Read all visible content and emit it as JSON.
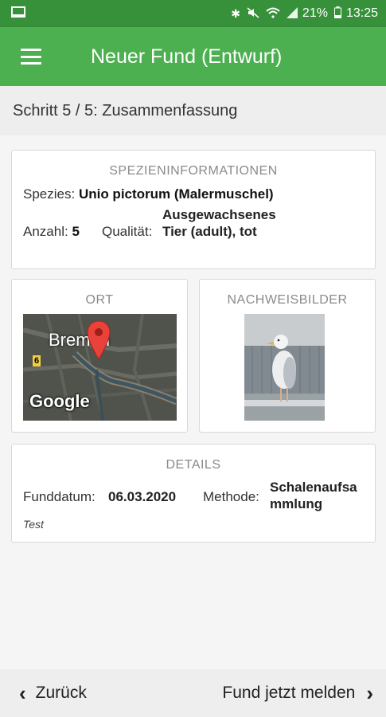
{
  "status_bar": {
    "battery": "21%",
    "time": "13:25"
  },
  "app_bar": {
    "title": "Neuer Fund (Entwurf)"
  },
  "step": {
    "text": "Schritt 5 / 5: Zusammenfassung"
  },
  "species_card": {
    "title": "SPEZIENINFORMATIONEN",
    "species_label": "Spezies:",
    "species_value": "Unio pictorum (Malermuschel)",
    "count_label": "Anzahl:",
    "count_value": "5",
    "quality_label": "Qualität:",
    "quality_value": "Ausgewachsenes Tier (adult), tot"
  },
  "location_card": {
    "title": "ORT",
    "map_city": "Bremen",
    "map_road": "6",
    "map_logo": "Google"
  },
  "images_card": {
    "title": "NACHWEISBILDER"
  },
  "details_card": {
    "title": "DETAILS",
    "date_label": "Funddatum:",
    "date_value": "06.03.2020",
    "method_label": "Methode:",
    "method_value": "Schalenaufsammlung",
    "note": "Test"
  },
  "bottom_bar": {
    "back_label": "Zurück",
    "submit_label": "Fund jetzt melden"
  },
  "colors": {
    "status_bar": "#37913a",
    "app_bar": "#4caf50"
  }
}
